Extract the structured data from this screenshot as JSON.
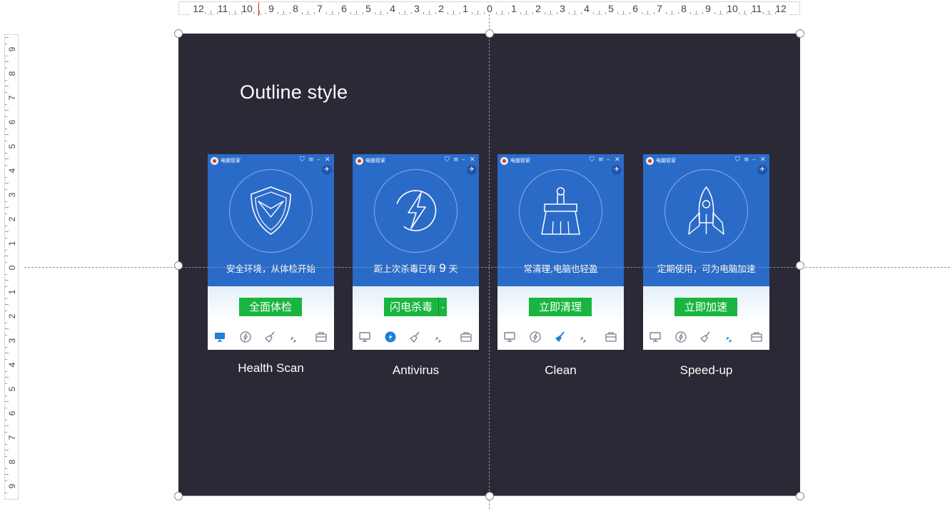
{
  "ruler": {
    "horizontal_labels": [
      "12",
      "11",
      "10",
      "9",
      "8",
      "7",
      "6",
      "5",
      "4",
      "3",
      "2",
      "1",
      "0",
      "1",
      "2",
      "3",
      "4",
      "5",
      "6",
      "7",
      "8",
      "9",
      "10",
      "11",
      "12"
    ],
    "vertical_labels": [
      "9",
      "8",
      "7",
      "6",
      "5",
      "4",
      "3",
      "2",
      "1",
      "0",
      "1",
      "2",
      "3",
      "4",
      "5",
      "6",
      "7",
      "8",
      "9"
    ]
  },
  "slide": {
    "title": "Outline style",
    "background_color": "#2a2935"
  },
  "colors": {
    "app_blue": "#2b6bc8",
    "button_green": "#19b540",
    "active_nav": "#1e7fd6",
    "inactive_nav": "#7a7f87"
  },
  "cards": [
    {
      "app_name": "电脑管家",
      "status_text": "安全环境，从体检开始",
      "button_label": "全面体检",
      "caption": "Health Scan",
      "hero_icon": "shield-icon",
      "active_nav": 0
    },
    {
      "app_name": "电脑管家",
      "status_prefix": "距上次杀毒已有",
      "status_number": "9",
      "status_suffix": "天",
      "button_label": "闪电杀毒",
      "caption": "Antivirus",
      "hero_icon": "lightning-icon",
      "active_nav": 1
    },
    {
      "app_name": "电脑管家",
      "status_text": "常清理,电脑也轻盈",
      "button_label": "立即清理",
      "caption": "Clean",
      "hero_icon": "brush-icon",
      "active_nav": 2
    },
    {
      "app_name": "电脑管家",
      "status_text": "定期使用，可为电脑加速",
      "button_label": "立即加速",
      "caption": "Speed-up",
      "hero_icon": "rocket-icon",
      "active_nav": 3
    }
  ],
  "nav_icons": [
    "monitor-icon",
    "lightning-circle-icon",
    "broom-icon",
    "rocket-icon",
    "toolbox-icon"
  ]
}
